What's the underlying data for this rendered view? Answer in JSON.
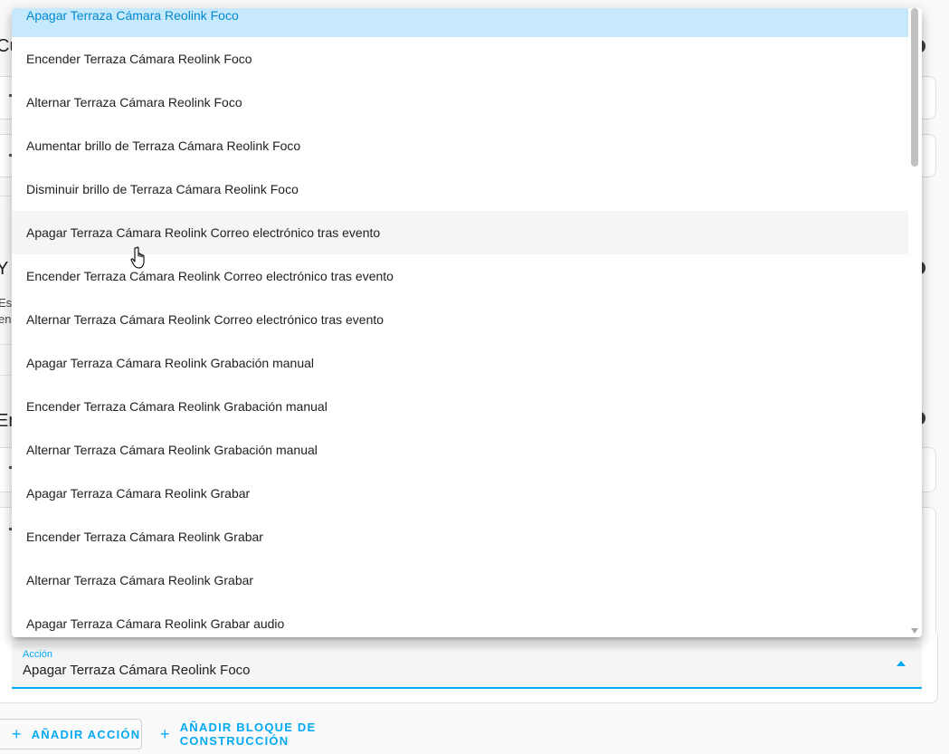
{
  "background": {
    "headings": [
      "Cu",
      "Y",
      "Er"
    ],
    "description_lines": [
      "Es",
      "en"
    ]
  },
  "menu": {
    "items": [
      {
        "label": "Apagar Terraza Cámara Reolink Foco",
        "state": "selected"
      },
      {
        "label": "Encender Terraza Cámara Reolink Foco",
        "state": ""
      },
      {
        "label": "Alternar Terraza Cámara Reolink Foco",
        "state": ""
      },
      {
        "label": "Aumentar brillo de Terraza Cámara Reolink Foco",
        "state": ""
      },
      {
        "label": "Disminuir brillo de Terraza Cámara Reolink Foco",
        "state": ""
      },
      {
        "label": "Apagar Terraza Cámara Reolink Correo electrónico tras evento",
        "state": "hovered"
      },
      {
        "label": "Encender Terraza Cámara Reolink Correo electrónico tras evento",
        "state": ""
      },
      {
        "label": "Alternar Terraza Cámara Reolink Correo electrónico tras evento",
        "state": ""
      },
      {
        "label": "Apagar Terraza Cámara Reolink Grabación manual",
        "state": ""
      },
      {
        "label": "Encender Terraza Cámara Reolink Grabación manual",
        "state": ""
      },
      {
        "label": "Alternar Terraza Cámara Reolink Grabación manual",
        "state": ""
      },
      {
        "label": "Apagar Terraza Cámara Reolink Grabar",
        "state": ""
      },
      {
        "label": "Encender Terraza Cámara Reolink Grabar",
        "state": ""
      },
      {
        "label": "Alternar Terraza Cámara Reolink Grabar",
        "state": ""
      },
      {
        "label": "Apagar Terraza Cámara Reolink Grabar audio",
        "state": ""
      }
    ]
  },
  "select": {
    "label": "Acción",
    "value": "Apagar Terraza Cámara Reolink Foco"
  },
  "buttons": {
    "add_action": "AÑADIR ACCIÓN",
    "add_block": "AÑADIR BLOQUE DE CONSTRUCCIÓN",
    "plus": "+"
  },
  "colors": {
    "accent": "#03a9f4",
    "selected_bg": "#c6e9fc",
    "hover_bg": "#f5f5f5"
  }
}
